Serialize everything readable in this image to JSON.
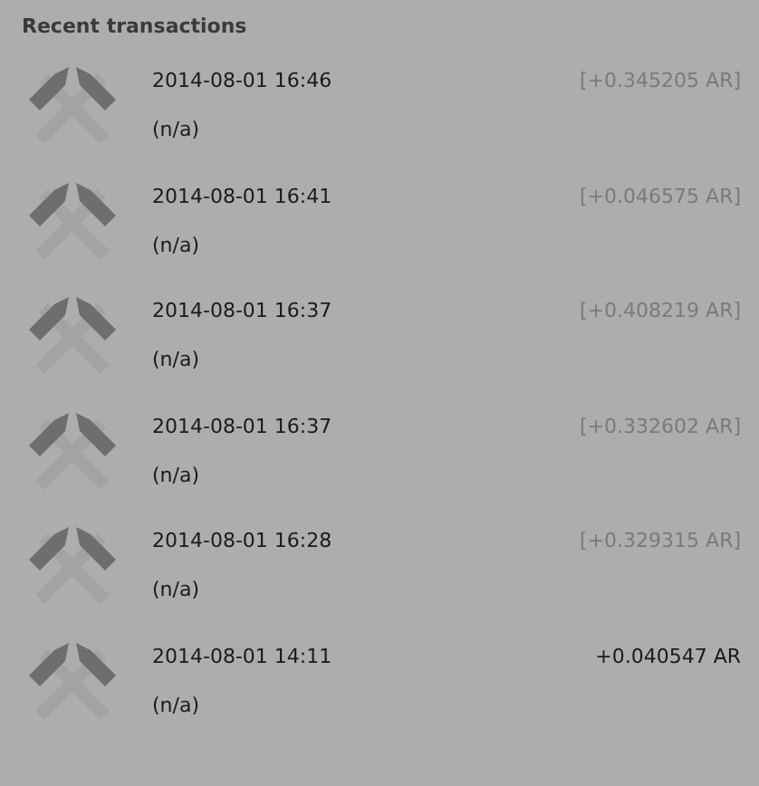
{
  "title": "Recent transactions",
  "transactions": [
    {
      "date": "2014-08-01 16:46",
      "label": "(n/a)",
      "amount": "[+0.345205 AR]",
      "confirmed": false
    },
    {
      "date": "2014-08-01 16:41",
      "label": "(n/a)",
      "amount": "[+0.046575 AR]",
      "confirmed": false
    },
    {
      "date": "2014-08-01 16:37",
      "label": "(n/a)",
      "amount": "[+0.408219 AR]",
      "confirmed": false
    },
    {
      "date": "2014-08-01 16:37",
      "label": "(n/a)",
      "amount": "[+0.332602 AR]",
      "confirmed": false
    },
    {
      "date": "2014-08-01 16:28",
      "label": "(n/a)",
      "amount": "[+0.329315 AR]",
      "confirmed": false
    },
    {
      "date": "2014-08-01 14:11",
      "label": "(n/a)",
      "amount": "+0.040547 AR",
      "confirmed": true
    }
  ]
}
